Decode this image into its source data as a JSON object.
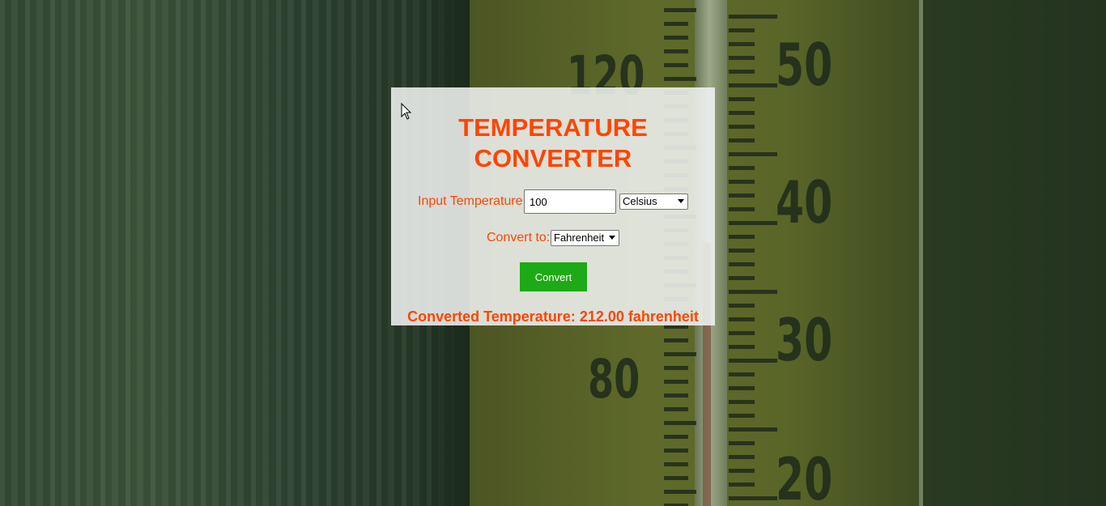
{
  "page": {
    "title_line1": "TEMPERATURE",
    "title_line2": "CONVERTER"
  },
  "form": {
    "input_label": "Input Temperature:",
    "input_value": "100",
    "from_unit": "Celsius",
    "convert_to_label": "Convert to:",
    "to_unit": "Fahrenheit",
    "convert_button": "Convert"
  },
  "result": {
    "text": "Converted Temperature: 212.00 fahrenheit"
  },
  "background": {
    "scale_left": [
      "120",
      "80"
    ],
    "scale_right": [
      "50",
      "40",
      "30",
      "20"
    ]
  },
  "colors": {
    "accent": "#ff4500",
    "button": "#1eaa16",
    "panel": "#f0f3f0"
  }
}
